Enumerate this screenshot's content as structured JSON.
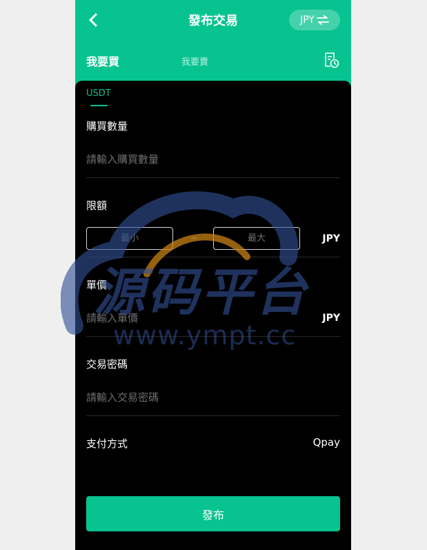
{
  "header": {
    "title": "發布交易",
    "currency_label": "JPY",
    "swap_icon": "swap-arrows-icon",
    "back_icon": "chevron-left-icon"
  },
  "tabs": {
    "buy_label": "我要買",
    "sell_label": "我要賣",
    "history_icon": "order-history-icon"
  },
  "coin_tab": {
    "label": "USDT"
  },
  "form": {
    "quantity": {
      "label": "購買數量",
      "placeholder": "請輸入購買數量",
      "value": ""
    },
    "limit": {
      "label": "限額",
      "min_placeholder": "最小",
      "max_placeholder": "最大",
      "separator": "~",
      "unit": "JPY"
    },
    "unit_price": {
      "label": "單價",
      "placeholder": "請輸入單價",
      "unit": "JPY",
      "value": ""
    },
    "trade_password": {
      "label": "交易密碼",
      "placeholder": "請輸入交易密碼",
      "value": ""
    },
    "payment": {
      "label": "支付方式",
      "value": "Qpay"
    }
  },
  "submit_label": "發布",
  "watermark": {
    "text": "源码平台",
    "url": "www.ympt.cc"
  },
  "colors": {
    "accent": "#07c38f",
    "background": "#000000",
    "page": "#efefef"
  }
}
